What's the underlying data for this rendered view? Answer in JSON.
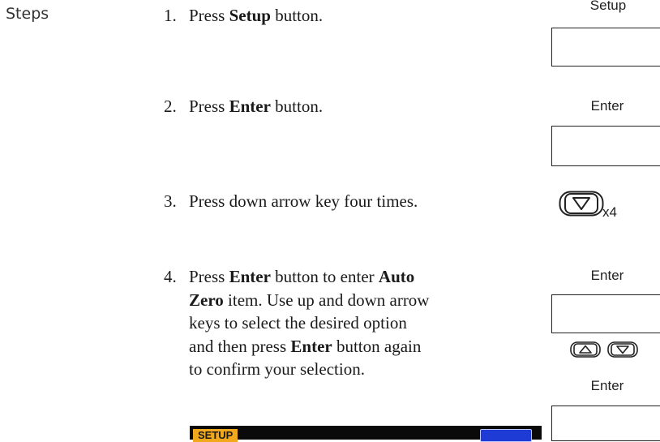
{
  "section_label": "Steps",
  "steps": [
    {
      "num": "1.",
      "pre": "Press ",
      "bold": "Setup",
      "post": " button."
    },
    {
      "num": "2.",
      "pre": "Press ",
      "bold": "Enter",
      "post": " button."
    },
    {
      "num": "3.",
      "text": "Press down arrow key four times."
    },
    {
      "num": "4.",
      "line1_pre": "Press ",
      "line1_bold": "Enter",
      "line1_mid": " button to enter ",
      "line1_bold2": "Auto",
      "line2_bold": "Zero",
      "line2_post": " item. Use up and down arrow",
      "line3": "keys to select the desired option",
      "line4_pre": "and then press ",
      "line4_bold": "Enter",
      "line4_post": " button again",
      "line5": "to confirm your selection."
    }
  ],
  "buttons": {
    "setup_caption": "Setup",
    "enter_caption_1": "Enter",
    "enter_caption_2": "Enter",
    "enter_caption_3": "Enter",
    "repeat_label": "x4"
  },
  "screen": {
    "title": "SETUP"
  },
  "icons": [
    "down-arrow-key-icon",
    "up-arrow-key-icon"
  ],
  "colors": {
    "screen_title_bg": "#f2a81d",
    "screen_bg": "#0a0a0a",
    "screen_highlight": "#1f3bd6"
  }
}
